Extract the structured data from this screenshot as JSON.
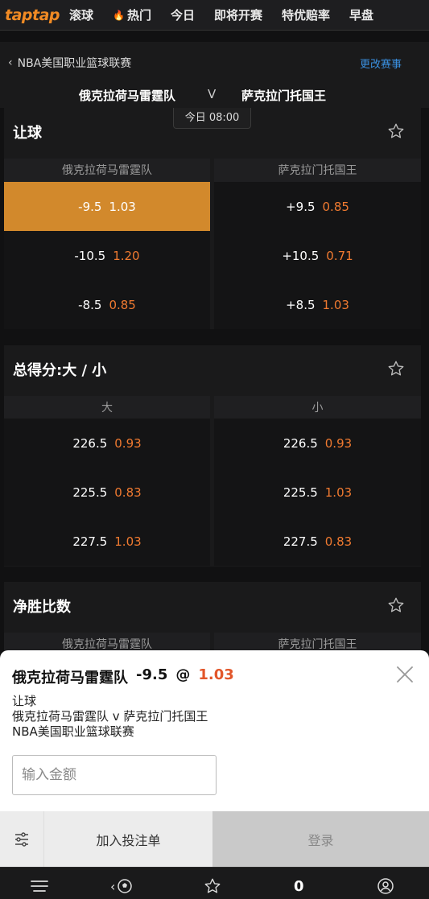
{
  "nav": {
    "logo": "taptap",
    "items": [
      "滚球",
      "热门",
      "今日",
      "即将开赛",
      "特优赔率",
      "早盘"
    ]
  },
  "match": {
    "league": "NBA美国职业篮球联赛",
    "change_link": "更改赛事",
    "home": "俄克拉荷马雷霆队",
    "vs": "V",
    "away": "萨克拉门托国王",
    "time": "今日 08:00"
  },
  "markets": [
    {
      "title": "让球",
      "col_left": "俄克拉荷马雷霆队",
      "col_right": "萨克拉门托国王",
      "rows": [
        {
          "left": {
            "line": "-9.5",
            "odd": "1.03"
          },
          "right": {
            "line": "+9.5",
            "odd": "0.85"
          }
        },
        {
          "left": {
            "line": "-10.5",
            "odd": "1.20"
          },
          "right": {
            "line": "+10.5",
            "odd": "0.71"
          }
        },
        {
          "left": {
            "line": "-8.5",
            "odd": "0.85"
          },
          "right": {
            "line": "+8.5",
            "odd": "1.03"
          }
        }
      ]
    },
    {
      "title": "总得分:大 / 小",
      "col_left": "大",
      "col_right": "小",
      "rows": [
        {
          "left": {
            "line": "226.5",
            "odd": "0.93"
          },
          "right": {
            "line": "226.5",
            "odd": "0.93"
          }
        },
        {
          "left": {
            "line": "225.5",
            "odd": "0.83"
          },
          "right": {
            "line": "225.5",
            "odd": "1.03"
          }
        },
        {
          "left": {
            "line": "227.5",
            "odd": "1.03"
          },
          "right": {
            "line": "227.5",
            "odd": "0.83"
          }
        }
      ]
    },
    {
      "title": "净胜比数",
      "col_left": "俄克拉荷马雷霆队",
      "col_right": "萨克拉门托国王"
    }
  ],
  "slip": {
    "selection": "俄克拉荷马雷霆队",
    "line": "-9.5",
    "at": "@",
    "price": "1.03",
    "market": "让球",
    "fixture": "俄克拉荷马雷霆队 v 萨克拉门托国王",
    "league": "NBA美国职业篮球联赛",
    "amount_placeholder": "输入金额",
    "add_label": "加入投注单",
    "login_label": "登录"
  },
  "bottom": {
    "bet_count": "0"
  },
  "colors": {
    "accent": "#f07a30",
    "selected": "#d2892c",
    "link": "#3a90e0",
    "price": "#e2562a"
  }
}
